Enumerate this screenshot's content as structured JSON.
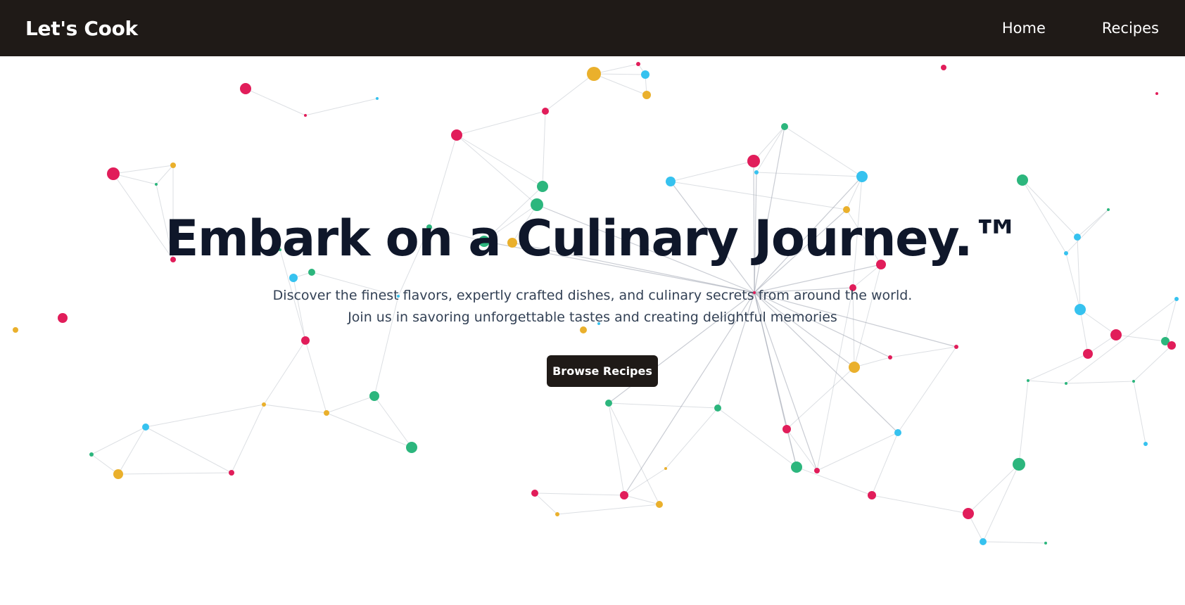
{
  "navbar": {
    "brand": "Let's Cook",
    "links": [
      {
        "label": "Home"
      },
      {
        "label": "Recipes"
      }
    ]
  },
  "hero": {
    "title": "Embark on a Culinary Journey.™",
    "subtitle": "Discover the finest flavors, expertly crafted dishes, and culinary secrets from around the world. Join us in savoring unforgettable tastes and creating delightful memories",
    "cta_label": "Browse Recipes"
  },
  "background": {
    "node_colors": [
      "#e11d5a",
      "#eab02c",
      "#2cb67d",
      "#36c2ef"
    ],
    "line_color": "#9ca3af"
  }
}
